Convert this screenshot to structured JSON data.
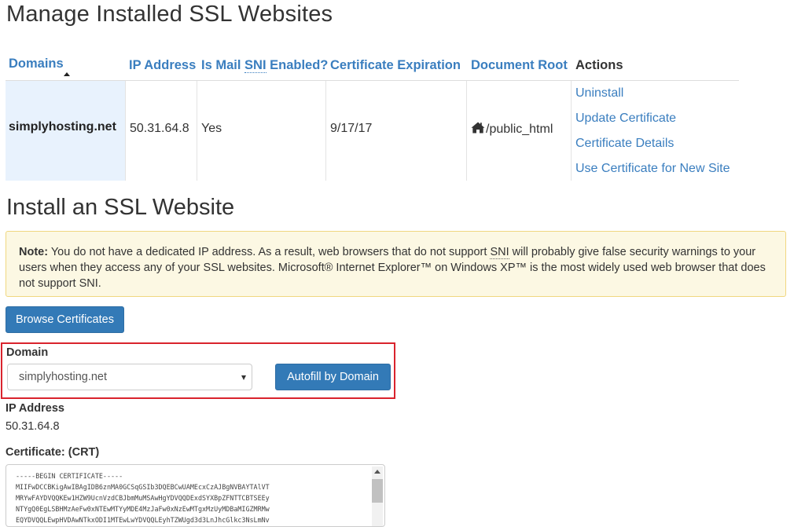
{
  "page_title": "Manage Installed SSL Websites",
  "table": {
    "headers": {
      "domains": "Domains",
      "ip_address": "IP Address",
      "mail_sni_prefix": "Is Mail ",
      "mail_sni_abbr": "SNI",
      "mail_sni_suffix": " Enabled?",
      "cert_expiration": "Certificate Expiration",
      "document_root": "Document Root",
      "actions": "Actions"
    },
    "rows": [
      {
        "domain": "simplyhosting.net",
        "ip": "50.31.64.8",
        "mail_sni": "Yes",
        "expiration": "9/17/17",
        "doc_root": "/public_html",
        "actions": [
          "Uninstall",
          "Update Certificate",
          "Certificate Details",
          "Use Certificate for New Site"
        ]
      }
    ]
  },
  "install_title": "Install an SSL Website",
  "note": {
    "label": "Note:",
    "text_1": " You do not have a dedicated IP address. As a result, web browsers that do not support ",
    "sni_1": "SNI",
    "text_2": " will probably give false security warnings to your users when they access any of your SSL websites. Microsoft® Internet Explorer™ on Windows XP™ is the most widely used web browser that does not support SNI."
  },
  "browse_button": "Browse Certificates",
  "domain_field": {
    "label": "Domain",
    "selected": "simplyhosting.net",
    "autofill_button": "Autofill by Domain"
  },
  "ip_field": {
    "label": "IP Address",
    "value": "50.31.64.8"
  },
  "certificate_field": {
    "label": "Certificate: (CRT)",
    "lines": [
      "-----BEGIN CERTIFICATE-----",
      "MIIFwDCCBKigAwIBAgIDB6znMA0GCSqGSIb3DQEBCwUAMEcxCzAJBgNVBAYTAlVT",
      "MRYwFAYDVQQKEw1HZW9UcnVzdCBJbmMuMSAwHgYDVQQDExdSYXBpZFNTTCBTSEEy",
      "NTYgQ0EgLSBHMzAeFw0xNTEwMTYyMDE4MzJaFw0xNzEwMTgxMzUyMDBaMIGZMRMw",
      "EQYDVQQLEwpHVDAwNTkxODI1MTEwLwYDVQQLEyhTZWUgd3d3LnJhcGlkc3NsLmNv"
    ]
  },
  "colors": {
    "link": "#3a7ebf",
    "primary_button": "#337ab7",
    "note_background": "#fcf8e3",
    "highlight_border": "#d9232d",
    "domain_cell_background": "#e8f2fd"
  }
}
